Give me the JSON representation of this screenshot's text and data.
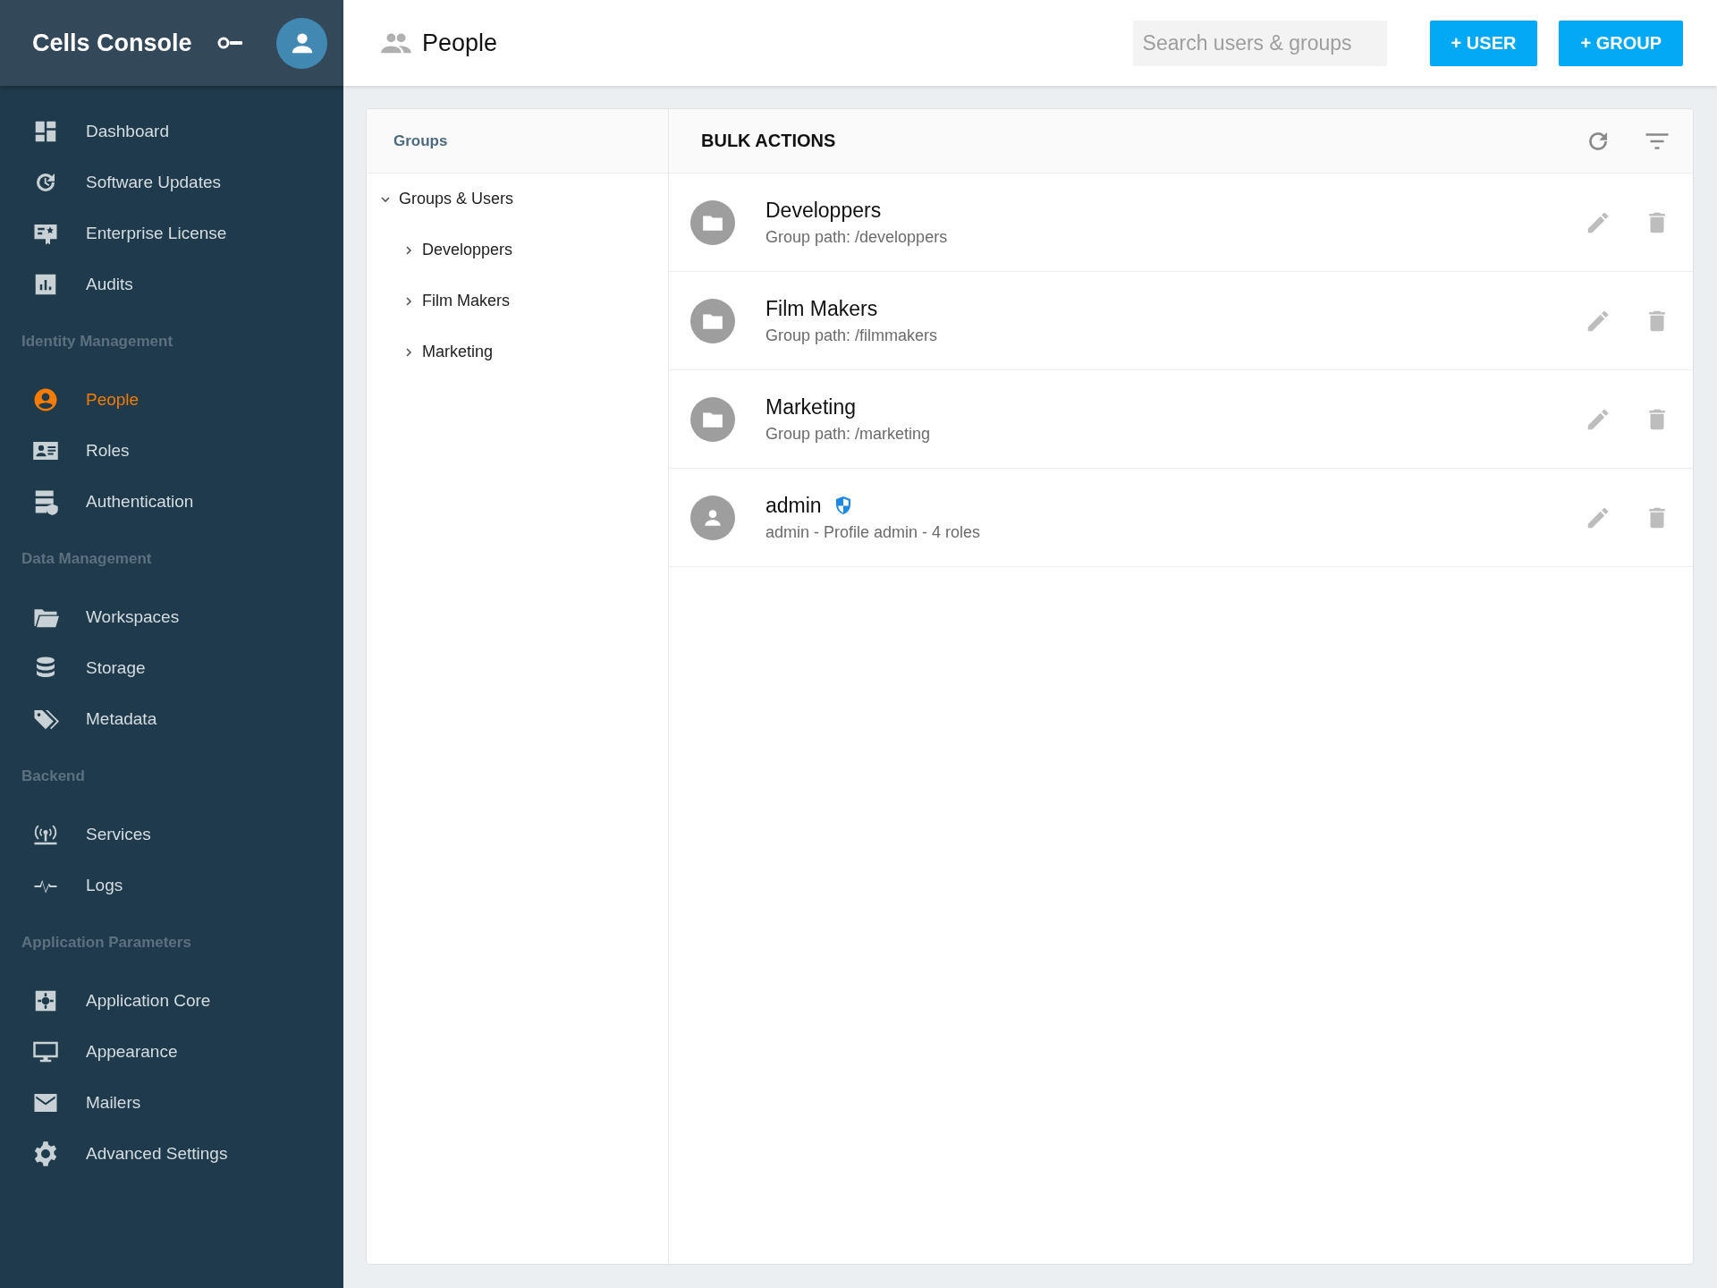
{
  "sidebar": {
    "title": "Cells Console",
    "items": [
      {
        "kind": "link",
        "label": "Dashboard",
        "selected": false
      },
      {
        "kind": "link",
        "label": "Software Updates",
        "selected": false
      },
      {
        "kind": "link",
        "label": "Enterprise License",
        "selected": false
      },
      {
        "kind": "link",
        "label": "Audits",
        "selected": false
      },
      {
        "kind": "section",
        "label": "Identity Management"
      },
      {
        "kind": "link",
        "label": "People",
        "selected": true
      },
      {
        "kind": "link",
        "label": "Roles",
        "selected": false
      },
      {
        "kind": "link",
        "label": "Authentication",
        "selected": false
      },
      {
        "kind": "section",
        "label": "Data Management"
      },
      {
        "kind": "link",
        "label": "Workspaces",
        "selected": false
      },
      {
        "kind": "link",
        "label": "Storage",
        "selected": false
      },
      {
        "kind": "link",
        "label": "Metadata",
        "selected": false
      },
      {
        "kind": "section",
        "label": "Backend"
      },
      {
        "kind": "link",
        "label": "Services",
        "selected": false
      },
      {
        "kind": "link",
        "label": "Logs",
        "selected": false
      },
      {
        "kind": "section",
        "label": "Application Parameters"
      },
      {
        "kind": "link",
        "label": "Application Core",
        "selected": false
      },
      {
        "kind": "link",
        "label": "Appearance",
        "selected": false
      },
      {
        "kind": "link",
        "label": "Mailers",
        "selected": false
      },
      {
        "kind": "link",
        "label": "Advanced Settings",
        "selected": false
      }
    ]
  },
  "header": {
    "title": "People",
    "search": {
      "placeholder": "Search users & groups"
    },
    "buttons": [
      "+ USER",
      "+ GROUP"
    ]
  },
  "groups_panel": {
    "heading": "Groups",
    "tree": [
      {
        "label": "Groups & Users",
        "expanded": true,
        "children": [
          {
            "label": "Developpers",
            "expanded": false
          },
          {
            "label": "Film Makers",
            "expanded": false
          },
          {
            "label": "Marketing",
            "expanded": false
          }
        ]
      }
    ]
  },
  "list": {
    "heading": "BULK ACTIONS",
    "rows": [
      {
        "kind": "group",
        "name": "Developpers",
        "detail": "Group path: /developpers",
        "admin": false
      },
      {
        "kind": "group",
        "name": "Film Makers",
        "detail": "Group path: /filmmakers",
        "admin": false
      },
      {
        "kind": "group",
        "name": "Marketing",
        "detail": "Group path: /marketing",
        "admin": false
      },
      {
        "kind": "user",
        "name": "admin",
        "detail": "admin - Profile admin - 4 roles",
        "admin": true
      }
    ]
  }
}
